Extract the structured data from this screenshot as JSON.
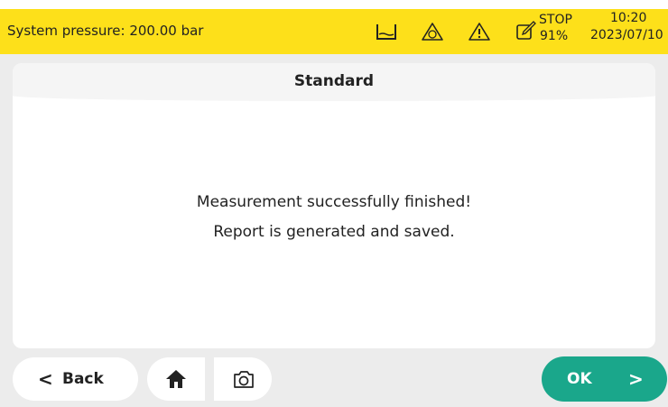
{
  "status_bar": {
    "system_pressure": "System pressure: 200.00 bar",
    "icons": [
      "tank-icon",
      "contamination-warning-icon",
      "warning-icon",
      "edit-icon"
    ],
    "stop_label": "STOP",
    "stop_percent": "91%",
    "time": "10:20",
    "date": "2023/07/10"
  },
  "panel": {
    "title": "Standard",
    "message_line1": "Measurement successfully finished!",
    "message_line2": "Report is generated and saved."
  },
  "buttons": {
    "back_chevron": "<",
    "back_label": "Back",
    "home_icon": "home-icon",
    "camera_icon": "camera-icon",
    "ok_label": "OK",
    "ok_chevron": ">"
  },
  "colors": {
    "status_bar": "#fde01a",
    "ok_button": "#1aa78b",
    "background": "#ececec"
  }
}
